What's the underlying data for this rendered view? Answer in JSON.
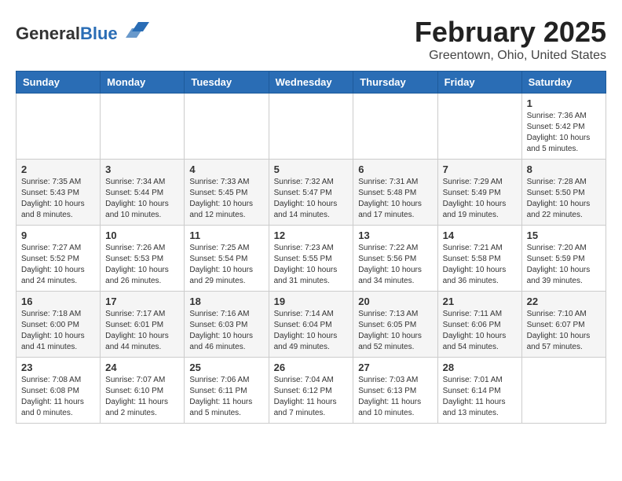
{
  "logo": {
    "general": "General",
    "blue": "Blue"
  },
  "header": {
    "month": "February 2025",
    "location": "Greentown, Ohio, United States"
  },
  "weekdays": [
    "Sunday",
    "Monday",
    "Tuesday",
    "Wednesday",
    "Thursday",
    "Friday",
    "Saturday"
  ],
  "weeks": [
    [
      {
        "day": "",
        "info": ""
      },
      {
        "day": "",
        "info": ""
      },
      {
        "day": "",
        "info": ""
      },
      {
        "day": "",
        "info": ""
      },
      {
        "day": "",
        "info": ""
      },
      {
        "day": "",
        "info": ""
      },
      {
        "day": "1",
        "info": "Sunrise: 7:36 AM\nSunset: 5:42 PM\nDaylight: 10 hours and 5 minutes."
      }
    ],
    [
      {
        "day": "2",
        "info": "Sunrise: 7:35 AM\nSunset: 5:43 PM\nDaylight: 10 hours and 8 minutes."
      },
      {
        "day": "3",
        "info": "Sunrise: 7:34 AM\nSunset: 5:44 PM\nDaylight: 10 hours and 10 minutes."
      },
      {
        "day": "4",
        "info": "Sunrise: 7:33 AM\nSunset: 5:45 PM\nDaylight: 10 hours and 12 minutes."
      },
      {
        "day": "5",
        "info": "Sunrise: 7:32 AM\nSunset: 5:47 PM\nDaylight: 10 hours and 14 minutes."
      },
      {
        "day": "6",
        "info": "Sunrise: 7:31 AM\nSunset: 5:48 PM\nDaylight: 10 hours and 17 minutes."
      },
      {
        "day": "7",
        "info": "Sunrise: 7:29 AM\nSunset: 5:49 PM\nDaylight: 10 hours and 19 minutes."
      },
      {
        "day": "8",
        "info": "Sunrise: 7:28 AM\nSunset: 5:50 PM\nDaylight: 10 hours and 22 minutes."
      }
    ],
    [
      {
        "day": "9",
        "info": "Sunrise: 7:27 AM\nSunset: 5:52 PM\nDaylight: 10 hours and 24 minutes."
      },
      {
        "day": "10",
        "info": "Sunrise: 7:26 AM\nSunset: 5:53 PM\nDaylight: 10 hours and 26 minutes."
      },
      {
        "day": "11",
        "info": "Sunrise: 7:25 AM\nSunset: 5:54 PM\nDaylight: 10 hours and 29 minutes."
      },
      {
        "day": "12",
        "info": "Sunrise: 7:23 AM\nSunset: 5:55 PM\nDaylight: 10 hours and 31 minutes."
      },
      {
        "day": "13",
        "info": "Sunrise: 7:22 AM\nSunset: 5:56 PM\nDaylight: 10 hours and 34 minutes."
      },
      {
        "day": "14",
        "info": "Sunrise: 7:21 AM\nSunset: 5:58 PM\nDaylight: 10 hours and 36 minutes."
      },
      {
        "day": "15",
        "info": "Sunrise: 7:20 AM\nSunset: 5:59 PM\nDaylight: 10 hours and 39 minutes."
      }
    ],
    [
      {
        "day": "16",
        "info": "Sunrise: 7:18 AM\nSunset: 6:00 PM\nDaylight: 10 hours and 41 minutes."
      },
      {
        "day": "17",
        "info": "Sunrise: 7:17 AM\nSunset: 6:01 PM\nDaylight: 10 hours and 44 minutes."
      },
      {
        "day": "18",
        "info": "Sunrise: 7:16 AM\nSunset: 6:03 PM\nDaylight: 10 hours and 46 minutes."
      },
      {
        "day": "19",
        "info": "Sunrise: 7:14 AM\nSunset: 6:04 PM\nDaylight: 10 hours and 49 minutes."
      },
      {
        "day": "20",
        "info": "Sunrise: 7:13 AM\nSunset: 6:05 PM\nDaylight: 10 hours and 52 minutes."
      },
      {
        "day": "21",
        "info": "Sunrise: 7:11 AM\nSunset: 6:06 PM\nDaylight: 10 hours and 54 minutes."
      },
      {
        "day": "22",
        "info": "Sunrise: 7:10 AM\nSunset: 6:07 PM\nDaylight: 10 hours and 57 minutes."
      }
    ],
    [
      {
        "day": "23",
        "info": "Sunrise: 7:08 AM\nSunset: 6:08 PM\nDaylight: 11 hours and 0 minutes."
      },
      {
        "day": "24",
        "info": "Sunrise: 7:07 AM\nSunset: 6:10 PM\nDaylight: 11 hours and 2 minutes."
      },
      {
        "day": "25",
        "info": "Sunrise: 7:06 AM\nSunset: 6:11 PM\nDaylight: 11 hours and 5 minutes."
      },
      {
        "day": "26",
        "info": "Sunrise: 7:04 AM\nSunset: 6:12 PM\nDaylight: 11 hours and 7 minutes."
      },
      {
        "day": "27",
        "info": "Sunrise: 7:03 AM\nSunset: 6:13 PM\nDaylight: 11 hours and 10 minutes."
      },
      {
        "day": "28",
        "info": "Sunrise: 7:01 AM\nSunset: 6:14 PM\nDaylight: 11 hours and 13 minutes."
      },
      {
        "day": "",
        "info": ""
      }
    ]
  ]
}
